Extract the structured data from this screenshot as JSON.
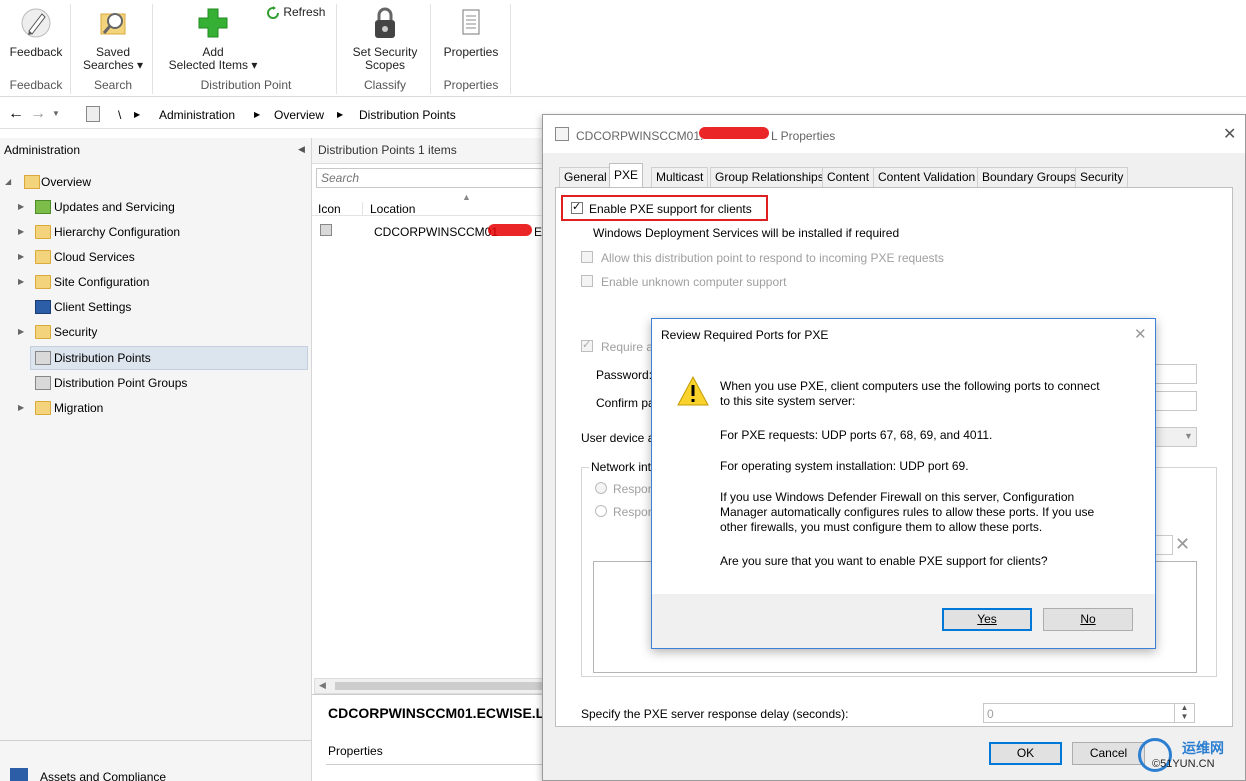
{
  "ribbon": {
    "feedback_label": "Feedback",
    "saved_searches_label1": "Saved",
    "saved_searches_label2": "Searches ▾",
    "add_label1": "Add",
    "add_label2": "Selected Items ▾",
    "refresh_label": "Refresh",
    "set_security_label1": "Set Security",
    "set_security_label2": "Scopes",
    "properties_label": "Properties",
    "groups": {
      "feedback": "Feedback",
      "search": "Search",
      "distribution_point": "Distribution Point",
      "classify": "Classify",
      "properties": "Properties"
    }
  },
  "nav": {
    "root": "\\",
    "crumbs": [
      "Administration",
      "Overview",
      "Distribution Points"
    ]
  },
  "left": {
    "title": "Administration",
    "root_item": "Overview",
    "items": [
      "Updates and Servicing",
      "Hierarchy Configuration",
      "Cloud Services",
      "Site Configuration",
      "Client Settings",
      "Security",
      "Distribution Points",
      "Distribution Point Groups",
      "Migration"
    ],
    "bottom_item": "Assets and Compliance"
  },
  "middle": {
    "title": "Distribution Points 1 items",
    "search_placeholder": "Search",
    "col_icon": "Icon",
    "col_location": "Location",
    "row_location": "CDCORPWINSCCM01",
    "row_suffix": "E.",
    "detail_title": "CDCORPWINSCCM01.ECWISE.LO",
    "detail_tab": "Properties"
  },
  "properties_dialog": {
    "title_prefix": "CDCORPWINSCCM01.",
    "title_suffix": "L Properties",
    "tabs": [
      "General",
      "PXE",
      "Multicast",
      "Group Relationships",
      "Content",
      "Content Validation",
      "Boundary Groups",
      "Security"
    ],
    "enable_pxe": "Enable PXE support for clients",
    "wds_note": "Windows Deployment Services will be installed if required",
    "allow_respond": "Allow this distribution point to respond to incoming PXE requests",
    "unknown_support": "Enable unknown computer support",
    "require_pw": "Require a",
    "password_label": "Password:",
    "confirm_label": "Confirm pas",
    "user_device": "User device a",
    "network_label": "Network inte",
    "respond1": "Respon",
    "respond2": "Respon",
    "delay_label": "Specify the PXE server response delay (seconds):",
    "delay_value": "0",
    "ok_label": "OK",
    "cancel_label": "Cancel"
  },
  "review_dialog": {
    "title": "Review Required Ports for PXE",
    "line1": "When you use PXE, client computers use the following ports to connect",
    "line2": "to this site system server:",
    "requests": "For PXE requests: UDP ports 67, 68, 69, and 4011.",
    "osinstall": "For operating system installation: UDP port 69.",
    "fw1": "If you use Windows Defender Firewall on this server, Configuration",
    "fw2": "Manager automatically configures rules to allow these ports. If you use",
    "fw3": "other firewalls, you must configure them to allow these ports.",
    "question": "Are you sure that you want to enable PXE support for clients?",
    "yes_label": "Yes",
    "no_label": "No"
  },
  "watermark": {
    "text1": "运维网",
    "text2": "©51YUN.CN"
  },
  "colors": {
    "accent": "#0078d7",
    "highlight_red": "#e02020",
    "selected": "#dce4ee",
    "plus_green": "#35b034"
  }
}
